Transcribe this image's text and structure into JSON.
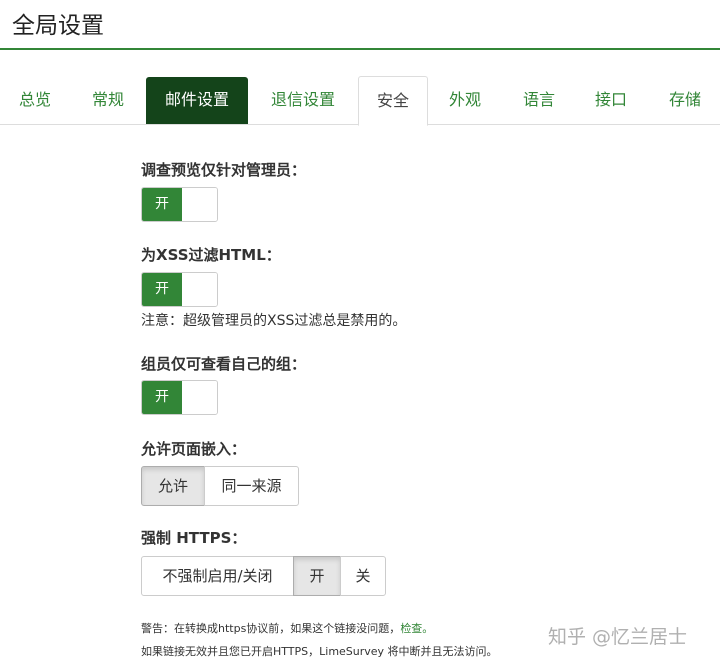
{
  "page": {
    "title": "全局设置"
  },
  "tabs": [
    {
      "label": "总览"
    },
    {
      "label": "常规"
    },
    {
      "label": "邮件设置"
    },
    {
      "label": "退信设置"
    },
    {
      "label": "安全"
    },
    {
      "label": "外观"
    },
    {
      "label": "语言"
    },
    {
      "label": "接口"
    },
    {
      "label": "存储"
    }
  ],
  "security": {
    "survey_preview_admin_only": {
      "label": "调查预览仅针对管理员：",
      "value": "开"
    },
    "filter_xss": {
      "label": "为XSS过滤HTML：",
      "value": "开",
      "note": "注意：超级管理员的XSS过滤总是禁用的。"
    },
    "usergroup_members_only": {
      "label": "组员仅可查看自己的组：",
      "value": "开"
    },
    "allow_iframe_embed": {
      "label": "允许页面嵌入：",
      "options": [
        "允许",
        "同一来源"
      ],
      "selected": "允许"
    },
    "force_https": {
      "label": "强制 HTTPS：",
      "options": [
        "不强制启用/关闭",
        "开",
        "关"
      ],
      "selected": "开"
    },
    "warning_prefix": "警告：在转换成https协议前，如果这个链接没问题，",
    "warning_link": "检查。",
    "warning_line2": "如果链接无效并且您已开启HTTPS，LimeSurvey 将中断并且无法访问。"
  },
  "watermark": "知乎 @忆兰居士",
  "colors": {
    "accent": "#328637",
    "dark_tab": "#14441a"
  }
}
